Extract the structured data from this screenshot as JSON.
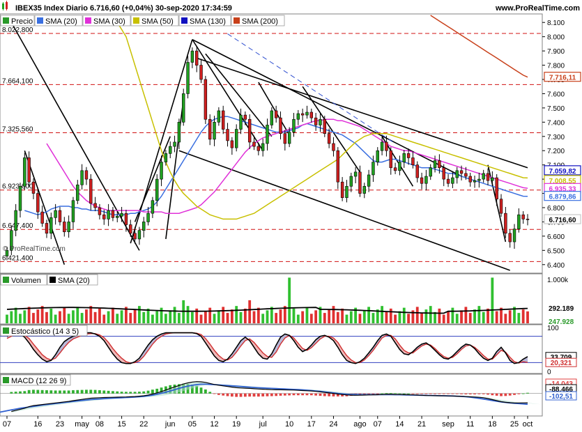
{
  "header": {
    "title": "IBEX35 Index Diario 6.716,60 (+0,04%) 30-sep-2020 17:34:59",
    "site": "www.ProRealTime.com",
    "watermark": "© ProRealTime.com"
  },
  "colors": {
    "price_up": "#20a020",
    "price_down": "#d02020",
    "sma20": "#3a6fe0",
    "sma30": "#e030d8",
    "sma50": "#c8c000",
    "sma130": "#1010c0",
    "sma200": "#c8401a",
    "volume_up": "#30c030",
    "volume_down": "#e03030",
    "stoch_k": "#000000",
    "stoch_d": "#d03030",
    "macd": "#000000",
    "signal": "#3060d0"
  },
  "chart_data": [
    {
      "type": "candlestick",
      "panel": "price",
      "legend": [
        "Precio",
        "SMA (20)",
        "SMA (30)",
        "SMA (50)",
        "SMA (130)",
        "SMA (200)"
      ],
      "ylim": [
        6350,
        8150
      ],
      "y_ticks": [
        "8.100",
        "8.000",
        "7.900",
        "7.800",
        "7.700",
        "7.600",
        "7.500",
        "7.400",
        "7.300",
        "7.200",
        "7.100",
        "7.000",
        "6.900",
        "6.800",
        "6.700",
        "6.600",
        "6.500",
        "6.400"
      ],
      "horizontal_levels": [
        {
          "label": "8.022,800",
          "value": 8022.8
        },
        {
          "label": "7.664,100",
          "value": 7664.1
        },
        {
          "label": "7.325,560",
          "value": 7325.56
        },
        {
          "label": "6.923,600",
          "value": 6923.6
        },
        {
          "label": "6.647,400",
          "value": 6647.4
        },
        {
          "label": "6.421,400",
          "value": 6421.4
        }
      ],
      "last_values": [
        {
          "label": "7.716,11",
          "value": 7716.11,
          "series": "SMA (200)"
        },
        {
          "label": "7.059,82",
          "value": 7059.82,
          "series": "SMA (130)"
        },
        {
          "label": "7.008,55",
          "value": 7008.55,
          "series": "SMA (50)"
        },
        {
          "label": "6.935,33",
          "value": 6935.33,
          "series": "SMA (30)"
        },
        {
          "label": "6.879,86",
          "value": 6879.86,
          "series": "SMA (20)"
        },
        {
          "label": "6.716,60",
          "value": 6716.6,
          "series": "Precio"
        }
      ],
      "x_ticks": [
        "07",
        "16",
        "23",
        "may",
        "08",
        "15",
        "22",
        "jun",
        "05",
        "12",
        "19",
        "jul",
        "10",
        "17",
        "24",
        "ago",
        "07",
        "14",
        "21",
        "sep",
        "11",
        "18",
        "25",
        "oct"
      ],
      "x_tick_index": [
        0,
        7,
        12,
        17,
        21,
        26,
        31,
        37,
        42,
        47,
        52,
        58,
        64,
        69,
        74,
        80,
        84,
        89,
        94,
        100,
        105,
        110,
        115,
        118
      ],
      "close": [
        6500,
        6640,
        6780,
        6950,
        7150,
        6980,
        6900,
        6770,
        6690,
        6620,
        6730,
        6780,
        6700,
        6630,
        6700,
        6850,
        6960,
        7060,
        7000,
        6830,
        6800,
        6750,
        6720,
        6780,
        6730,
        6740,
        6760,
        6680,
        6620,
        6580,
        6640,
        6700,
        6760,
        6850,
        7000,
        7120,
        7180,
        7230,
        7260,
        7400,
        7600,
        7820,
        7900,
        7800,
        7700,
        7420,
        7280,
        7400,
        7480,
        7350,
        7270,
        7220,
        7350,
        7450,
        7420,
        7260,
        7230,
        7200,
        7250,
        7380,
        7480,
        7430,
        7320,
        7250,
        7330,
        7420,
        7460,
        7450,
        7470,
        7430,
        7380,
        7420,
        7320,
        7250,
        7200,
        6980,
        6870,
        6950,
        7020,
        7050,
        6900,
        6950,
        7030,
        7120,
        7200,
        7260,
        7200,
        7080,
        7060,
        7120,
        7180,
        7150,
        7100,
        7010,
        6970,
        7020,
        7080,
        7130,
        7080,
        7000,
        6970,
        7010,
        7060,
        7040,
        7020,
        6980,
        6990,
        7000,
        7040,
        6990,
        7010,
        6860,
        6760,
        6620,
        6560,
        6650,
        6750,
        6720,
        6716.6
      ],
      "series": [
        {
          "name": "SMA (20)",
          "values": [
            6780,
            6770,
            6760,
            6750,
            6760,
            6770,
            6790,
            6800,
            6810,
            6810,
            6810,
            6800,
            6800,
            6790,
            6790,
            6780,
            6780,
            6780,
            6770,
            6760,
            6750,
            6750,
            6750,
            6750,
            6760,
            6760,
            6770,
            6780,
            6790,
            6810,
            6840,
            6880,
            6930,
            6980,
            7030,
            7080,
            7130,
            7180,
            7230,
            7280,
            7330,
            7370,
            7400,
            7420,
            7430,
            7440,
            7440,
            7430,
            7420,
            7410,
            7400,
            7390,
            7380,
            7370,
            7360,
            7350,
            7340,
            7330,
            7330,
            7330,
            7340,
            7350,
            7360,
            7380,
            7390,
            7380,
            7370,
            7360,
            7350,
            7340,
            7330,
            7320,
            7310,
            7290,
            7270,
            7250,
            7220,
            7190,
            7160,
            7130,
            7120,
            7120,
            7130,
            7140,
            7140,
            7130,
            7120,
            7110,
            7100,
            7090,
            7080,
            7080,
            7080,
            7070,
            7060,
            7050,
            7040,
            7040,
            7030,
            7020,
            7010,
            7000,
            6990,
            6980,
            6970,
            6960,
            6950,
            6940,
            6930,
            6920,
            6910,
            6900,
            6890,
            6880,
            6879.86
          ]
        },
        {
          "name": "SMA (30)",
          "values": [
            7250,
            7200,
            7150,
            7100,
            7050,
            7000,
            6950,
            6910,
            6880,
            6850,
            6830,
            6810,
            6800,
            6790,
            6780,
            6780,
            6780,
            6780,
            6780,
            6780,
            6780,
            6780,
            6770,
            6770,
            6770,
            6770,
            6770,
            6760,
            6760,
            6760,
            6760,
            6770,
            6780,
            6790,
            6800,
            6820,
            6850,
            6880,
            6910,
            6950,
            6990,
            7030,
            7070,
            7110,
            7150,
            7190,
            7220,
            7250,
            7270,
            7290,
            7300,
            7310,
            7320,
            7330,
            7340,
            7350,
            7360,
            7370,
            7380,
            7390,
            7400,
            7410,
            7410,
            7420,
            7420,
            7420,
            7410,
            7410,
            7400,
            7390,
            7380,
            7370,
            7350,
            7330,
            7310,
            7290,
            7270,
            7250,
            7230,
            7220,
            7210,
            7200,
            7200,
            7190,
            7180,
            7170,
            7160,
            7150,
            7140,
            7130,
            7120,
            7110,
            7100,
            7090,
            7080,
            7070,
            7060,
            7050,
            7040,
            7030,
            7020,
            7010,
            7000,
            6990,
            6980,
            6970,
            6960,
            6950,
            6940,
            6935.33
          ]
        },
        {
          "name": "SMA (50)",
          "values": [
            8100,
            8050,
            8000,
            7900,
            7800,
            7700,
            7600,
            7500,
            7400,
            7300,
            7200,
            7120,
            7050,
            6990,
            6940,
            6900,
            6870,
            6840,
            6810,
            6790,
            6770,
            6750,
            6740,
            6730,
            6720,
            6720,
            6720,
            6720,
            6730,
            6740,
            6750,
            6760,
            6780,
            6800,
            6820,
            6840,
            6860,
            6880,
            6900,
            6920,
            6940,
            6960,
            6980,
            7000,
            7020,
            7040,
            7060,
            7080,
            7100,
            7120,
            7140,
            7170,
            7200,
            7230,
            7260,
            7280,
            7300,
            7310,
            7320,
            7320,
            7320,
            7320,
            7310,
            7300,
            7290,
            7280,
            7270,
            7260,
            7250,
            7240,
            7230,
            7220,
            7210,
            7200,
            7190,
            7180,
            7170,
            7160,
            7150,
            7140,
            7130,
            7120,
            7110,
            7100,
            7090,
            7080,
            7070,
            7060,
            7050,
            7040,
            7030,
            7020,
            7010,
            7008.55
          ]
        },
        {
          "name": "SMA (130)",
          "values": [
            7059.82
          ]
        },
        {
          "name": "SMA (200)",
          "values": [
            8150,
            8130,
            8110,
            8090,
            8070,
            8050,
            8030,
            8010,
            7990,
            7970,
            7950,
            7930,
            7910,
            7890,
            7870,
            7850,
            7830,
            7810,
            7790,
            7770,
            7750,
            7730,
            7716.11
          ]
        }
      ]
    },
    {
      "type": "bar",
      "panel": "volume",
      "legend": [
        "Volumen",
        "SMA (20)"
      ],
      "ylim": [
        0,
        1000000
      ],
      "y_ticks": [
        "1.000k"
      ],
      "last_values": [
        {
          "label": "292.189",
          "value": 292189,
          "series": "SMA (20)"
        },
        {
          "label": "247.928",
          "value": 247928,
          "series": "Volumen"
        }
      ]
    },
    {
      "type": "line",
      "panel": "stochastic",
      "legend": [
        "Estocástico (14 3 5)"
      ],
      "ylim": [
        0,
        100
      ],
      "y_ticks": [
        "100",
        "0"
      ],
      "levels": [
        80,
        20
      ],
      "last_values": [
        {
          "label": "33,709",
          "value": 33.709,
          "series": "K"
        },
        {
          "label": "20,321",
          "value": 20.321,
          "series": "D"
        }
      ],
      "k": [
        80,
        85,
        88,
        85,
        78,
        65,
        50,
        38,
        28,
        22,
        25,
        38,
        55,
        68,
        75,
        80,
        82,
        85,
        88,
        88,
        85,
        80,
        70,
        55,
        40,
        28,
        20,
        18,
        18,
        22,
        30,
        45,
        60,
        72,
        80,
        85,
        88,
        88,
        88,
        88,
        88,
        88,
        88,
        86,
        80,
        65,
        50,
        35,
        25,
        22,
        28,
        40,
        55,
        70,
        78,
        70,
        55,
        40,
        30,
        28,
        40,
        60,
        78,
        85,
        82,
        70,
        55,
        45,
        50,
        60,
        72,
        80,
        82,
        78,
        70,
        55,
        38,
        25,
        20,
        18,
        22,
        30,
        42,
        55,
        70,
        82,
        85,
        80,
        65,
        50,
        40,
        38,
        45,
        55,
        62,
        65,
        58,
        48,
        38,
        30,
        28,
        35,
        45,
        55,
        62,
        60,
        52,
        40,
        30,
        25,
        30,
        45,
        55,
        42,
        25,
        18,
        20,
        28,
        33.709
      ],
      "d": [
        75,
        80,
        84,
        85,
        82,
        75,
        62,
        50,
        38,
        30,
        26,
        30,
        42,
        55,
        66,
        74,
        78,
        82,
        85,
        86,
        86,
        83,
        77,
        66,
        52,
        40,
        30,
        22,
        19,
        20,
        24,
        34,
        48,
        62,
        73,
        80,
        85,
        87,
        88,
        88,
        88,
        88,
        88,
        87,
        84,
        75,
        62,
        48,
        36,
        28,
        26,
        32,
        44,
        58,
        70,
        74,
        66,
        54,
        42,
        34,
        32,
        44,
        62,
        76,
        82,
        76,
        64,
        52,
        48,
        54,
        64,
        74,
        80,
        80,
        76,
        66,
        50,
        36,
        26,
        20,
        20,
        26,
        36,
        48,
        62,
        76,
        82,
        82,
        74,
        60,
        48,
        42,
        42,
        50,
        58,
        62,
        60,
        52,
        42,
        34,
        30,
        32,
        40,
        50,
        58,
        60,
        55,
        46,
        36,
        28,
        28,
        38,
        48,
        44,
        32,
        22,
        19,
        22,
        20.321
      ]
    },
    {
      "type": "line",
      "panel": "macd",
      "legend": [
        "MACD (12 26 9)"
      ],
      "last_values": [
        {
          "label": "-14,043",
          "value": -14.043,
          "series": "histogram"
        },
        {
          "label": "-88,466",
          "value": -88.466,
          "series": "MACD"
        },
        {
          "label": "-102,51",
          "value": -102.51,
          "series": "signal"
        }
      ],
      "macd": [
        -170,
        -160,
        -150,
        -140,
        -125,
        -115,
        -110,
        -105,
        -100,
        -95,
        -90,
        -85,
        -80,
        -75,
        -68,
        -62,
        -56,
        -50,
        -45,
        -42,
        -40,
        -38,
        -37,
        -36,
        -35,
        -34,
        -33,
        -31,
        -29,
        -26,
        -22,
        -15,
        -5,
        5,
        18,
        32,
        48,
        62,
        75,
        90,
        100,
        108,
        112,
        110,
        105,
        95,
        85,
        78,
        72,
        66,
        60,
        55,
        52,
        50,
        48,
        45,
        42,
        40,
        38,
        36,
        35,
        35,
        34,
        33,
        32,
        30,
        28,
        26,
        24,
        20,
        15,
        10,
        5,
        0,
        -5,
        -10,
        -14,
        -16,
        -17,
        -16,
        -15,
        -14,
        -13,
        -12,
        -10,
        -8,
        -8,
        -9,
        -10,
        -11,
        -12,
        -13,
        -15,
        -17,
        -19,
        -20,
        -21,
        -22,
        -22,
        -23,
        -24,
        -26,
        -28,
        -30,
        -32,
        -34,
        -36,
        -40,
        -48,
        -58,
        -68,
        -78,
        -84,
        -88,
        -90,
        -90,
        -89,
        -88.466
      ],
      "signal": [
        -180,
        -172,
        -164,
        -156,
        -148,
        -140,
        -134,
        -128,
        -122,
        -116,
        -110,
        -105,
        -100,
        -95,
        -90,
        -85,
        -80,
        -75,
        -70,
        -66,
        -62,
        -58,
        -55,
        -52,
        -49,
        -46,
        -44,
        -42,
        -40,
        -38,
        -36,
        -34,
        -31,
        -27,
        -22,
        -16,
        -8,
        2,
        12,
        24,
        36,
        48,
        60,
        70,
        78,
        84,
        88,
        88,
        86,
        84,
        81,
        78,
        75,
        72,
        69,
        66,
        63,
        60,
        57,
        54,
        52,
        50,
        48,
        46,
        44,
        42,
        40,
        38,
        36,
        34,
        31,
        28,
        24,
        20,
        15,
        10,
        5,
        0,
        -4,
        -7,
        -9,
        -10,
        -11,
        -11,
        -11,
        -11,
        -11,
        -11,
        -11,
        -11,
        -12,
        -12,
        -13,
        -14,
        -15,
        -16,
        -17,
        -18,
        -19,
        -20,
        -21,
        -22,
        -23,
        -24,
        -26,
        -28,
        -31,
        -35,
        -40,
        -46,
        -53,
        -60,
        -67,
        -74,
        -80,
        -85,
        -89,
        -93,
        -96,
        -99,
        -102.51
      ]
    }
  ]
}
